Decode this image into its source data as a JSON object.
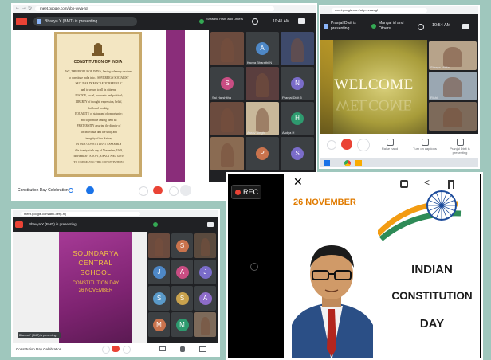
{
  "meet1": {
    "url": "meet.google.com/ubp-vvva-rgf",
    "presenter_chip": "Bhavya Y (BMT) is presenting",
    "join_label": "Shradha Rishi and Others",
    "time": "10:41 AM",
    "doc": {
      "heading": "CONSTITUTION OF INDIA",
      "lines": [
        "WE, THE PEOPLE OF INDIA, having solemnly resolved",
        "to constitute India into a SOVEREIGN SOCIALIST",
        "SECULAR DEMOCRATIC REPUBLIC",
        "and to secure to all its citizens:",
        "JUSTICE, social, economic and political;",
        "LIBERTY of thought, expression, belief,",
        "faith and worship;",
        "EQUALITY of status and of opportunity;",
        "and to promote among them all",
        "FRATERNITY assuring the dignity of",
        "the individual and the unity and",
        "integrity of the Nation;",
        "IN OUR CONSTITUENT ASSEMBLY",
        "this twenty-sixth day of November, 1949,",
        "do HEREBY ADOPT, ENACT AND GIVE",
        "TO OURSELVES THIS CONSTITUTION."
      ]
    },
    "tiles": [
      {
        "label": "",
        "initial": ""
      },
      {
        "label": "Kavya Bharathi N",
        "initial": "A"
      },
      {
        "label": "",
        "initial": ""
      },
      {
        "label": "Sai Harshitha",
        "initial": "S"
      },
      {
        "label": "",
        "initial": ""
      },
      {
        "label": "Pranjal Dixit 5",
        "initial": "N"
      },
      {
        "label": "",
        "initial": ""
      },
      {
        "label": "Aarav Singh",
        "initial": ""
      },
      {
        "label": "Aadya H",
        "initial": "H"
      },
      {
        "label": "",
        "initial": ""
      },
      {
        "label": "",
        "initial": "P"
      },
      {
        "label": "",
        "initial": "S"
      }
    ],
    "meeting_title": "Constitution Day Celebration"
  },
  "meet2": {
    "url": "meet.google.com/ubp-vvva-rgf",
    "presenter_chip": "Pranjal Dixit is presenting",
    "join_label": "Mangal id and Others",
    "time": "10:54 AM",
    "slide_title": "WELCOME",
    "slide_shadow": "WELCOME",
    "tiles": [
      {
        "label": "Shreya Nikita",
        "initial": ""
      },
      {
        "label": "Rishi",
        "initial": ""
      },
      {
        "label": "",
        "initial": ""
      }
    ],
    "controls": [
      {
        "label": "Raise hand",
        "icon": "hand-icon"
      },
      {
        "label": "Turn on captions",
        "icon": "captions-icon"
      },
      {
        "label": "Pranjal Dixit is presenting",
        "icon": "present-icon"
      }
    ]
  },
  "meet3": {
    "url": "meet.google.com/abc-defg-hij",
    "presenter_chip": "Bhavya Y (BMT) is presenting",
    "slide": {
      "line1": "SOUNDARYA",
      "line2": "CENTRAL",
      "line3": "SCHOOL",
      "line4": "CONSTITUTION DAY",
      "line5": "26 NOVEMBER"
    },
    "tiles": [
      {
        "label": "",
        "initial": ""
      },
      {
        "label": "",
        "initial": "S"
      },
      {
        "label": "",
        "initial": ""
      },
      {
        "label": "",
        "initial": "J"
      },
      {
        "label": "",
        "initial": "A"
      },
      {
        "label": "",
        "initial": "J"
      },
      {
        "label": "",
        "initial": "S"
      },
      {
        "label": "",
        "initial": "S"
      },
      {
        "label": "",
        "initial": "A"
      },
      {
        "label": "",
        "initial": "M"
      },
      {
        "label": "",
        "initial": "M"
      },
      {
        "label": "",
        "initial": ""
      }
    ],
    "caption_chip": "Bhavya Y (BMT) is presenting",
    "meeting_title": "Constitution Day Celebration"
  },
  "story": {
    "rec_label": "REC",
    "date_text": "26 NOVEMBER",
    "title_lines": [
      "INDIAN",
      "CONSTITUTION",
      "DAY"
    ]
  },
  "colors": {
    "background": "#9fc7bd",
    "meet_dark": "#202124",
    "meet_red": "#ea4335",
    "slide_purple": "#8a2d7a",
    "ashoka_blue": "#1d4c9b",
    "saffron": "#f39c12",
    "india_green": "#2e8b57"
  }
}
